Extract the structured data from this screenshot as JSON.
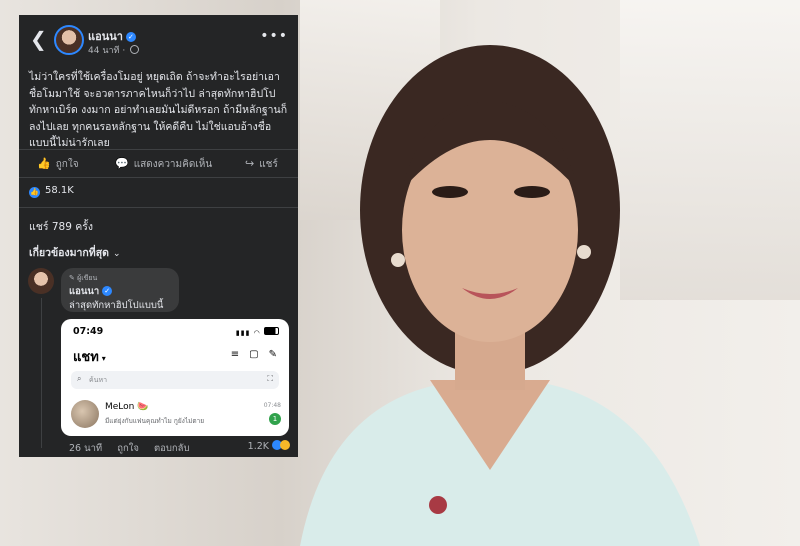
{
  "post": {
    "back_icon": "chevron-left-icon",
    "author": "แอนนา",
    "time": "44 นาที",
    "more_icon": "more-horizontal-icon",
    "text": "ไม่ว่าใครที่ใช้เครื่องโมอยู่ หยุดเถิด ถ้าจะทำอะไรอย่าเอาชื่อโมมาใช้ จะอวตารภาคไหนก็ว่าไป ล่าสุดทักหาฮิปโป ทักหาเบิร์ด งงมาก อย่าทำเลยมันไม่ดีหรอก ถ้ามีหลักฐานก็ลงไปเลย ทุกคนรอหลักฐาน ให้คดีคืบ ไม่ใช่แอบอ้างชื่อ แบบนี้ไม่น่ารักเลย",
    "actions": {
      "like": "ถูกใจ",
      "comment": "แสดงความคิดเห็น",
      "share": "แชร์"
    },
    "likes_count": "58.1K",
    "shares": "แชร์ 789 ครั้ง",
    "relevant": "เกี่ยวข้องมากที่สุด"
  },
  "comment": {
    "badge": "ผู้เขียน",
    "author": "แอนนา",
    "text": "ล่าสุดทักหาฮิปโปแบบนี้",
    "time": "26 นาที",
    "like": "ถูกใจ",
    "reply": "ตอบกลับ",
    "reactions": "1.2K"
  },
  "phone": {
    "time": "07:49",
    "title": "แชท",
    "search_placeholder": "ค้นหา",
    "chat_name": "MeLon",
    "chat_msg": "มีแต่ยุ่งกับแฟนคุณทำไม กูยังไม่ตาย",
    "chat_time": "07:48",
    "chat_unread": "1"
  }
}
